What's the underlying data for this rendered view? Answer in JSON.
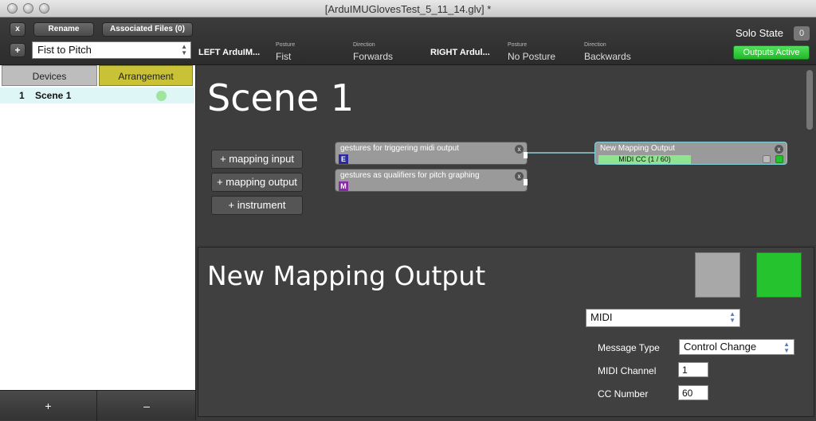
{
  "window": {
    "title": "[ArduIMUGlovesTest_5_11_14.glv] *"
  },
  "toolbar": {
    "close_label": "x",
    "rename_label": "Rename",
    "associated_files_label": "Associated Files (0)",
    "add_label": "+",
    "preset_value": "Fist to Pitch",
    "left_device": "LEFT ArduIM...",
    "left_posture_caption": "Posture",
    "left_posture_value": "Fist",
    "left_direction_caption": "Direction",
    "left_direction_value": "Forwards",
    "right_device": "RIGHT Ardul...",
    "right_posture_caption": "Posture",
    "right_posture_value": "No Posture",
    "right_direction_caption": "Direction",
    "right_direction_value": "Backwards",
    "solo_state_label": "Solo State",
    "solo_count": "0",
    "outputs_active_label": "Outputs Active"
  },
  "left_panel": {
    "tabs": [
      {
        "label": "Devices"
      },
      {
        "label": "Arrangement",
        "active": true
      }
    ],
    "scenes": [
      {
        "number": "1",
        "name": "Scene 1",
        "status_color": "#9fe49f"
      }
    ],
    "add_label": "+",
    "remove_label": "–"
  },
  "scene": {
    "title": "Scene 1",
    "buttons": [
      {
        "label": "+ mapping input"
      },
      {
        "label": "+ mapping output"
      },
      {
        "label": "+ instrument"
      }
    ],
    "input_nodes": [
      {
        "title": "gestures for triggering midi output",
        "badge": "E",
        "badge_color": "#2b2b9e"
      },
      {
        "title": "gestures as qualifiers for pitch graphing",
        "badge": "M",
        "badge_color": "#8a2aa8"
      }
    ],
    "output_node": {
      "title": "New Mapping Output",
      "detail": "MIDI CC (1 / 60)"
    },
    "close_glyph": "x"
  },
  "inspector": {
    "title": "New Mapping Output",
    "output_type": "MIDI",
    "message_type_label": "Message Type",
    "message_type_value": "Control Change",
    "midi_channel_label": "MIDI Channel",
    "midi_channel_value": "1",
    "cc_number_label": "CC Number",
    "cc_number_value": "60"
  },
  "colors": {
    "accent_green": "#25c32d",
    "arrangement_tab": "#c9c236",
    "selected_row": "#dff6f6"
  }
}
